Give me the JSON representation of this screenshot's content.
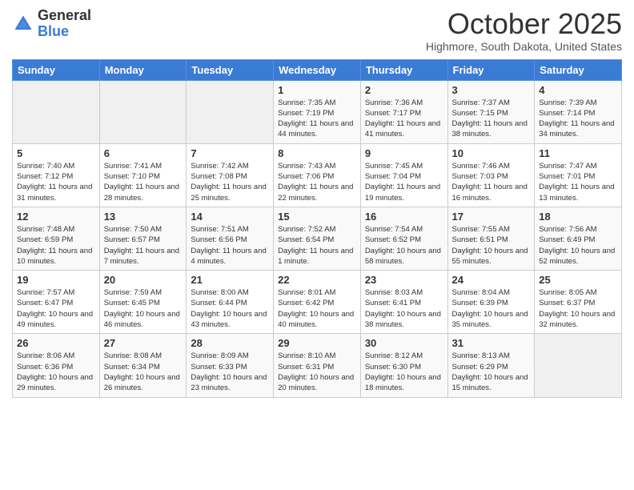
{
  "header": {
    "logo_general": "General",
    "logo_blue": "Blue",
    "month_title": "October 2025",
    "subtitle": "Highmore, South Dakota, United States"
  },
  "days_of_week": [
    "Sunday",
    "Monday",
    "Tuesday",
    "Wednesday",
    "Thursday",
    "Friday",
    "Saturday"
  ],
  "weeks": [
    [
      {
        "num": "",
        "info": ""
      },
      {
        "num": "",
        "info": ""
      },
      {
        "num": "",
        "info": ""
      },
      {
        "num": "1",
        "info": "Sunrise: 7:35 AM\nSunset: 7:19 PM\nDaylight: 11 hours and 44 minutes."
      },
      {
        "num": "2",
        "info": "Sunrise: 7:36 AM\nSunset: 7:17 PM\nDaylight: 11 hours and 41 minutes."
      },
      {
        "num": "3",
        "info": "Sunrise: 7:37 AM\nSunset: 7:15 PM\nDaylight: 11 hours and 38 minutes."
      },
      {
        "num": "4",
        "info": "Sunrise: 7:39 AM\nSunset: 7:14 PM\nDaylight: 11 hours and 34 minutes."
      }
    ],
    [
      {
        "num": "5",
        "info": "Sunrise: 7:40 AM\nSunset: 7:12 PM\nDaylight: 11 hours and 31 minutes."
      },
      {
        "num": "6",
        "info": "Sunrise: 7:41 AM\nSunset: 7:10 PM\nDaylight: 11 hours and 28 minutes."
      },
      {
        "num": "7",
        "info": "Sunrise: 7:42 AM\nSunset: 7:08 PM\nDaylight: 11 hours and 25 minutes."
      },
      {
        "num": "8",
        "info": "Sunrise: 7:43 AM\nSunset: 7:06 PM\nDaylight: 11 hours and 22 minutes."
      },
      {
        "num": "9",
        "info": "Sunrise: 7:45 AM\nSunset: 7:04 PM\nDaylight: 11 hours and 19 minutes."
      },
      {
        "num": "10",
        "info": "Sunrise: 7:46 AM\nSunset: 7:03 PM\nDaylight: 11 hours and 16 minutes."
      },
      {
        "num": "11",
        "info": "Sunrise: 7:47 AM\nSunset: 7:01 PM\nDaylight: 11 hours and 13 minutes."
      }
    ],
    [
      {
        "num": "12",
        "info": "Sunrise: 7:48 AM\nSunset: 6:59 PM\nDaylight: 11 hours and 10 minutes."
      },
      {
        "num": "13",
        "info": "Sunrise: 7:50 AM\nSunset: 6:57 PM\nDaylight: 11 hours and 7 minutes."
      },
      {
        "num": "14",
        "info": "Sunrise: 7:51 AM\nSunset: 6:56 PM\nDaylight: 11 hours and 4 minutes."
      },
      {
        "num": "15",
        "info": "Sunrise: 7:52 AM\nSunset: 6:54 PM\nDaylight: 11 hours and 1 minute."
      },
      {
        "num": "16",
        "info": "Sunrise: 7:54 AM\nSunset: 6:52 PM\nDaylight: 10 hours and 58 minutes."
      },
      {
        "num": "17",
        "info": "Sunrise: 7:55 AM\nSunset: 6:51 PM\nDaylight: 10 hours and 55 minutes."
      },
      {
        "num": "18",
        "info": "Sunrise: 7:56 AM\nSunset: 6:49 PM\nDaylight: 10 hours and 52 minutes."
      }
    ],
    [
      {
        "num": "19",
        "info": "Sunrise: 7:57 AM\nSunset: 6:47 PM\nDaylight: 10 hours and 49 minutes."
      },
      {
        "num": "20",
        "info": "Sunrise: 7:59 AM\nSunset: 6:45 PM\nDaylight: 10 hours and 46 minutes."
      },
      {
        "num": "21",
        "info": "Sunrise: 8:00 AM\nSunset: 6:44 PM\nDaylight: 10 hours and 43 minutes."
      },
      {
        "num": "22",
        "info": "Sunrise: 8:01 AM\nSunset: 6:42 PM\nDaylight: 10 hours and 40 minutes."
      },
      {
        "num": "23",
        "info": "Sunrise: 8:03 AM\nSunset: 6:41 PM\nDaylight: 10 hours and 38 minutes."
      },
      {
        "num": "24",
        "info": "Sunrise: 8:04 AM\nSunset: 6:39 PM\nDaylight: 10 hours and 35 minutes."
      },
      {
        "num": "25",
        "info": "Sunrise: 8:05 AM\nSunset: 6:37 PM\nDaylight: 10 hours and 32 minutes."
      }
    ],
    [
      {
        "num": "26",
        "info": "Sunrise: 8:06 AM\nSunset: 6:36 PM\nDaylight: 10 hours and 29 minutes."
      },
      {
        "num": "27",
        "info": "Sunrise: 8:08 AM\nSunset: 6:34 PM\nDaylight: 10 hours and 26 minutes."
      },
      {
        "num": "28",
        "info": "Sunrise: 8:09 AM\nSunset: 6:33 PM\nDaylight: 10 hours and 23 minutes."
      },
      {
        "num": "29",
        "info": "Sunrise: 8:10 AM\nSunset: 6:31 PM\nDaylight: 10 hours and 20 minutes."
      },
      {
        "num": "30",
        "info": "Sunrise: 8:12 AM\nSunset: 6:30 PM\nDaylight: 10 hours and 18 minutes."
      },
      {
        "num": "31",
        "info": "Sunrise: 8:13 AM\nSunset: 6:29 PM\nDaylight: 10 hours and 15 minutes."
      },
      {
        "num": "",
        "info": ""
      }
    ]
  ]
}
